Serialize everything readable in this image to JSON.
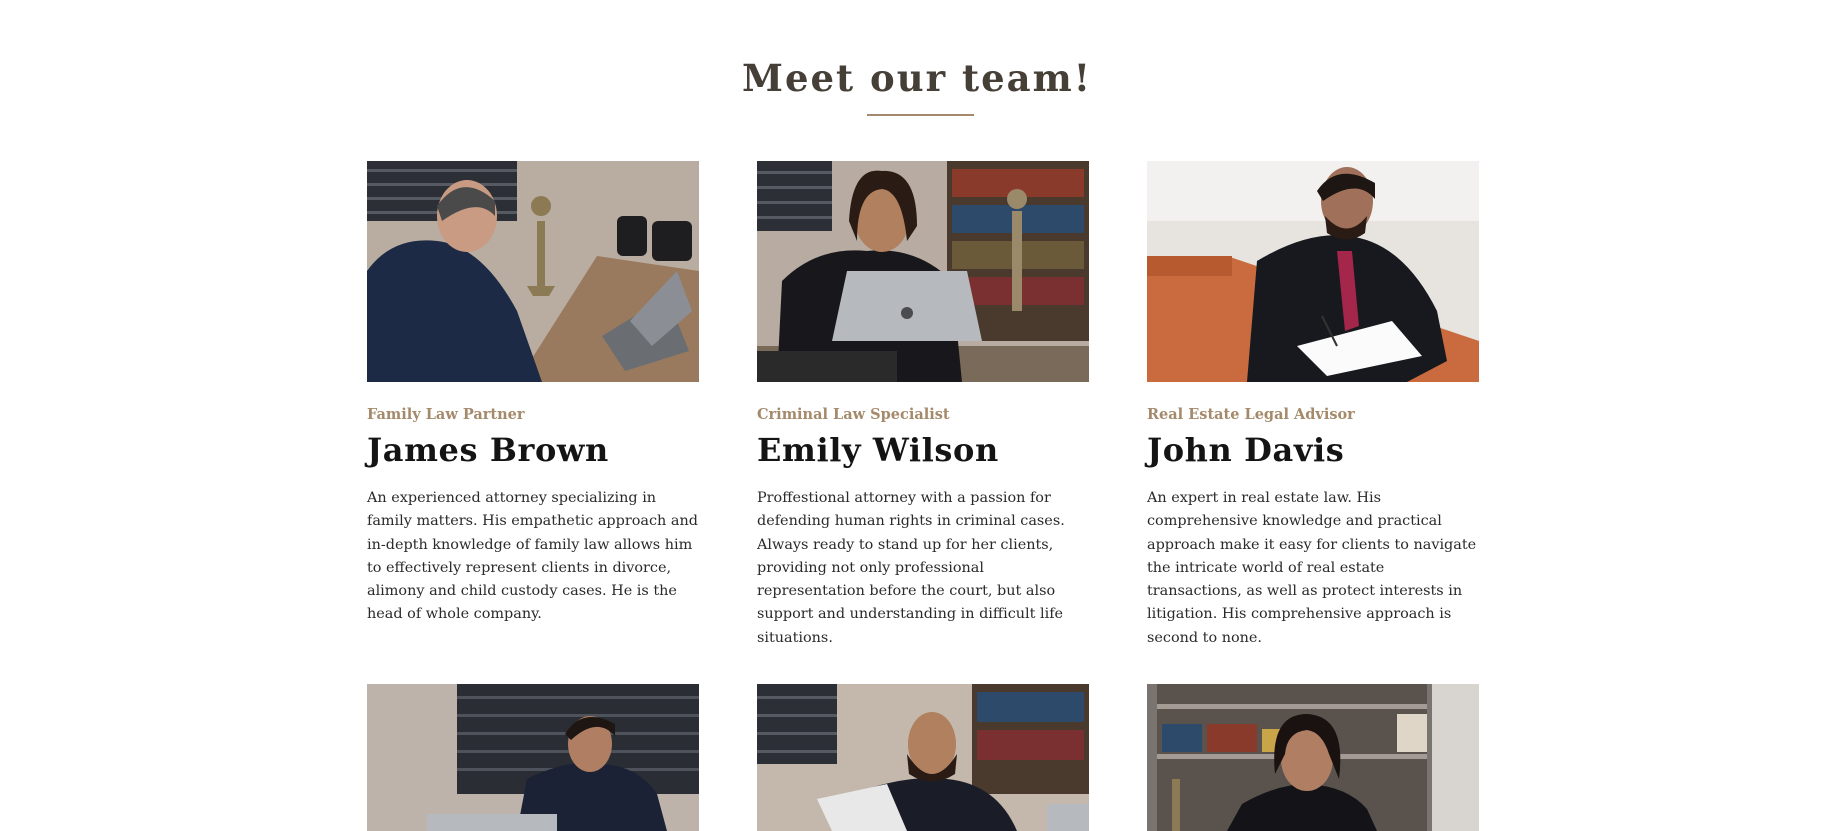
{
  "section": {
    "title": "Meet our team!"
  },
  "team": [
    {
      "role": "Family Law Partner",
      "name": "James Brown",
      "bio": "An experienced attorney specializing in family matters. His empathetic approach and in-depth knowledge of family law allows him to effectively represent clients in divorce, alimony and child custody cases. He is the head of whole company."
    },
    {
      "role": "Criminal Law Specialist",
      "name": "Emily Wilson",
      "bio": "Proffestional attorney with a passion for defending human rights in criminal cases. Always ready to stand up for her clients, providing not only professional representation before the court, but also support and understanding in difficult life situations."
    },
    {
      "role": "Real Estate Legal Advisor",
      "name": "John Davis",
      "bio": "An expert in real estate law. His comprehensive knowledge and practical approach make it easy for clients to navigate the intricate world of real estate transactions, as well as protect interests in litigation. His comprehensive approach is second to none."
    }
  ],
  "colors": {
    "accent": "#a48a6b",
    "heading": "#463f37",
    "text": "#2a2a2a"
  }
}
